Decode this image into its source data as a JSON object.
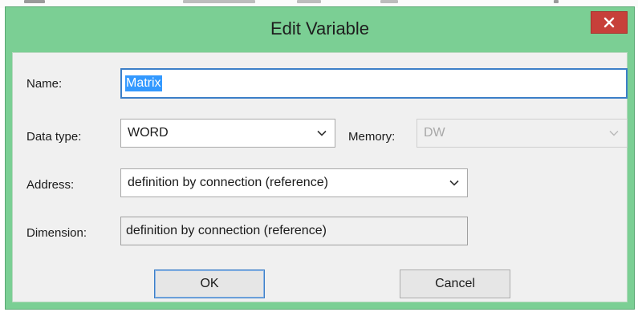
{
  "window": {
    "title": "Edit Variable"
  },
  "form": {
    "name": {
      "label": "Name:",
      "value": "Matrix"
    },
    "data_type": {
      "label": "Data type:",
      "value": "WORD"
    },
    "memory": {
      "label": "Memory:",
      "value": "DW",
      "disabled": true
    },
    "address": {
      "label": "Address:",
      "value": "definition by connection (reference)"
    },
    "dimension": {
      "label": "Dimension:",
      "value": "definition by connection (reference)"
    }
  },
  "buttons": {
    "ok_label": "OK",
    "cancel_label": "Cancel"
  },
  "colors": {
    "frame": "#7bcf94",
    "close": "#c7403a",
    "selection": "#3399ff",
    "focus_border": "#3c7fc8"
  },
  "icons": {
    "close": "close-icon",
    "dropdown": "chevron-down-icon"
  }
}
